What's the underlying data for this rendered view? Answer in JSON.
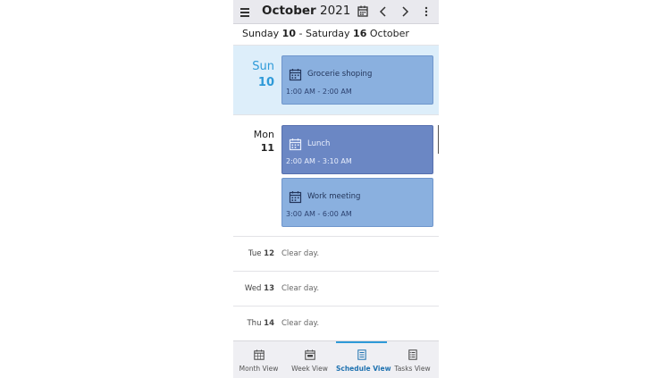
{
  "header": {
    "month": "October",
    "year": "2021",
    "icons": [
      "menu-icon",
      "calendar-icon",
      "chevron-left-icon",
      "chevron-right-icon",
      "more-vertical-icon"
    ]
  },
  "week_range": {
    "start_day": "Sunday",
    "start_date": "10",
    "separator": "-",
    "end_day": "Saturday",
    "end_date": "16",
    "month": "October"
  },
  "days": [
    {
      "name": "Sun",
      "date": "10",
      "today": true,
      "events": [
        {
          "title": "Grocerie shoping",
          "time": "1:00 AM - 2:00 AM"
        }
      ]
    },
    {
      "name": "Mon",
      "date": "11",
      "today": false,
      "events": [
        {
          "title": "Lunch",
          "time": "2:00 AM - 3:10 AM"
        },
        {
          "title": "Work meeting",
          "time": "3:00 AM - 6:00 AM"
        }
      ]
    }
  ],
  "clear_days": [
    {
      "name": "Tue",
      "date": "12",
      "text": "Clear day."
    },
    {
      "name": "Wed",
      "date": "13",
      "text": "Clear day."
    },
    {
      "name": "Thu",
      "date": "14",
      "text": "Clear day."
    }
  ],
  "tabs": [
    {
      "label": "Month View",
      "active": false
    },
    {
      "label": "Week View",
      "active": false
    },
    {
      "label": "Schedule View",
      "active": true
    },
    {
      "label": "Tasks View",
      "active": false
    }
  ],
  "colors": {
    "today_background": "#ddeefa",
    "today_text": "#2e9ad8",
    "event": "#8ab0df",
    "event_selected": "#6b87c4",
    "active_tab": "#1f72b0"
  }
}
